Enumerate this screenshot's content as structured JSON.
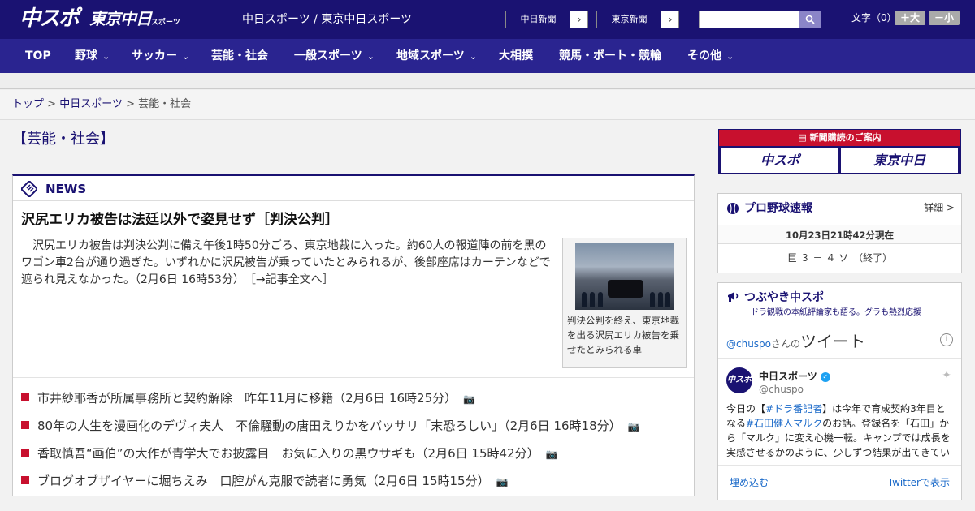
{
  "header": {
    "logo_main": "中スポ",
    "logo_tokyo": "東京中日",
    "logo_tokyo_small": "スポーツ",
    "site_links": "中日スポーツ / 東京中日スポーツ",
    "paper_btn_1": "中日新聞",
    "paper_btn_2": "東京新聞",
    "arrow": "›",
    "search_placeholder": "",
    "moji_label": "文字（0）",
    "font_larger": "＋大",
    "font_smaller": "－小"
  },
  "nav": {
    "items": [
      {
        "label": "TOP"
      },
      {
        "label": "野球"
      },
      {
        "label": "サッカー"
      },
      {
        "label": "芸能・社会"
      },
      {
        "label": "一般スポーツ"
      },
      {
        "label": "地域スポーツ"
      },
      {
        "label": "大相撲"
      },
      {
        "label": "競馬・ボート・競輪"
      },
      {
        "label": "その他"
      }
    ]
  },
  "breadcrumb": {
    "top": "トップ",
    "sep": " > ",
    "section": "中日スポーツ",
    "current": "芸能・社会"
  },
  "page_title": "【芸能・社会】",
  "news": {
    "label": "NEWS",
    "headline": "沢尻エリカ被告は法廷以外で姿見せず［判決公判］",
    "body": "沢尻エリカ被告は判決公判に備え午後1時50分ごろ、東京地裁に入った。約60人の報道陣の前を黒のワゴン車2台が通り過ぎた。いずれかに沢尻被告が乗っていたとみられるが、後部座席はカーテンなどで遮られ見えなかった。（2月6日 16時53分）　［→記事全文へ］",
    "caption": "判決公判を終え、東京地裁を出る沢尻エリカ被告を乗せたとみられる車",
    "items": [
      {
        "title": "市井紗耶香が所属事務所と契約解除　昨年11月に移籍",
        "time": "（2月6日 16時25分）"
      },
      {
        "title": "80年の人生を漫画化のデヴィ夫人　不倫騒動の唐田えりかをバッサリ「末恐ろしい」",
        "time": "（2月6日 16時18分）"
      },
      {
        "title": "香取慎吾“画伯”の大作が青学大でお披露目　お気に入りの黒ウサギも",
        "time": "（2月6日 15時42分）"
      },
      {
        "title": "ブログオブザイヤーに堀ちえみ　口腔がん克服で読者に勇気",
        "time": "（2月6日 15時15分）"
      }
    ]
  },
  "subscription": {
    "title": "新聞購読のご案内",
    "btn_1": "中スポ",
    "btn_2": "東京中日"
  },
  "baseball": {
    "title": "プロ野球速報",
    "detail": "詳細 >",
    "timestamp": "10月23日21時42分現在",
    "score": "巨 ３ － ４ ソ　（終了）"
  },
  "tweets": {
    "title": "つぶやき中スポ",
    "subtitle": "ドラ観戦の本紙評論家も語る。グラも熱烈応援",
    "handle_link": "@chuspo",
    "handle_suffix": "さんの",
    "tweets_word": "ツイート",
    "info": "i",
    "account_name": "中日スポーツ",
    "account_handle": "@chuspo",
    "avatar_text": "中スポ",
    "text_1": "今日の【",
    "tag_1": "#ドラ番記者",
    "text_2": "】は今年で育成契約3年目となる",
    "tag_2": "#石田健人マルク",
    "text_3": "のお話。登録名を「石田」から「マルク」に変え心機一転。キャンプでは成長を実感させるかのように、少しずつ結果が出てきている",
    "embed": "埋め込む",
    "view_on_twitter": "Twitterで表示"
  }
}
